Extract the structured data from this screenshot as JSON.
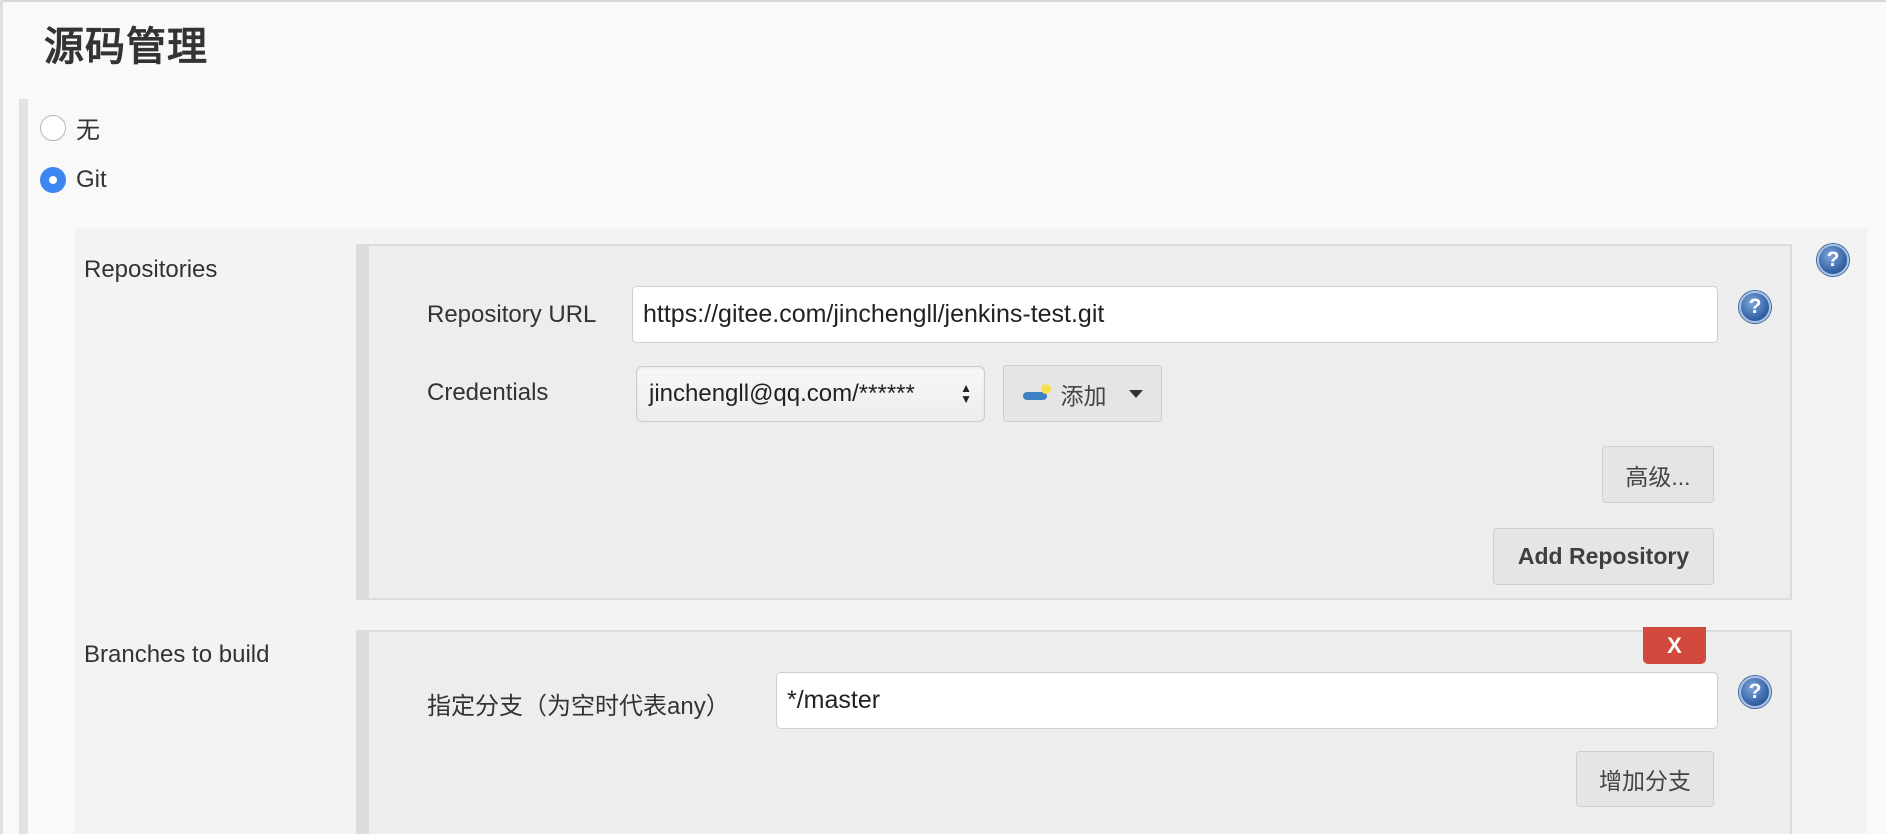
{
  "section": {
    "title": "源码管理"
  },
  "scm_options": [
    {
      "label": "无",
      "checked": false
    },
    {
      "label": "Git",
      "checked": true
    }
  ],
  "repositories": {
    "label": "Repositories",
    "repository_url_label": "Repository URL",
    "repository_url_value": "https://gitee.com/jinchengll/jenkins-test.git",
    "credentials_label": "Credentials",
    "credentials_selected": "jinchengll@qq.com/******",
    "add_credentials_label": "添加",
    "advanced_label": "高级...",
    "add_repository_label": "Add Repository"
  },
  "branches": {
    "label": "Branches to build",
    "delete_label": "X",
    "branch_specifier_label": "指定分支（为空时代表any）",
    "branch_specifier_value": "*/master",
    "add_branch_label": "增加分支"
  },
  "icons": {
    "help": "?",
    "select_arrows_up": "▲",
    "select_arrows_down": "▼"
  }
}
